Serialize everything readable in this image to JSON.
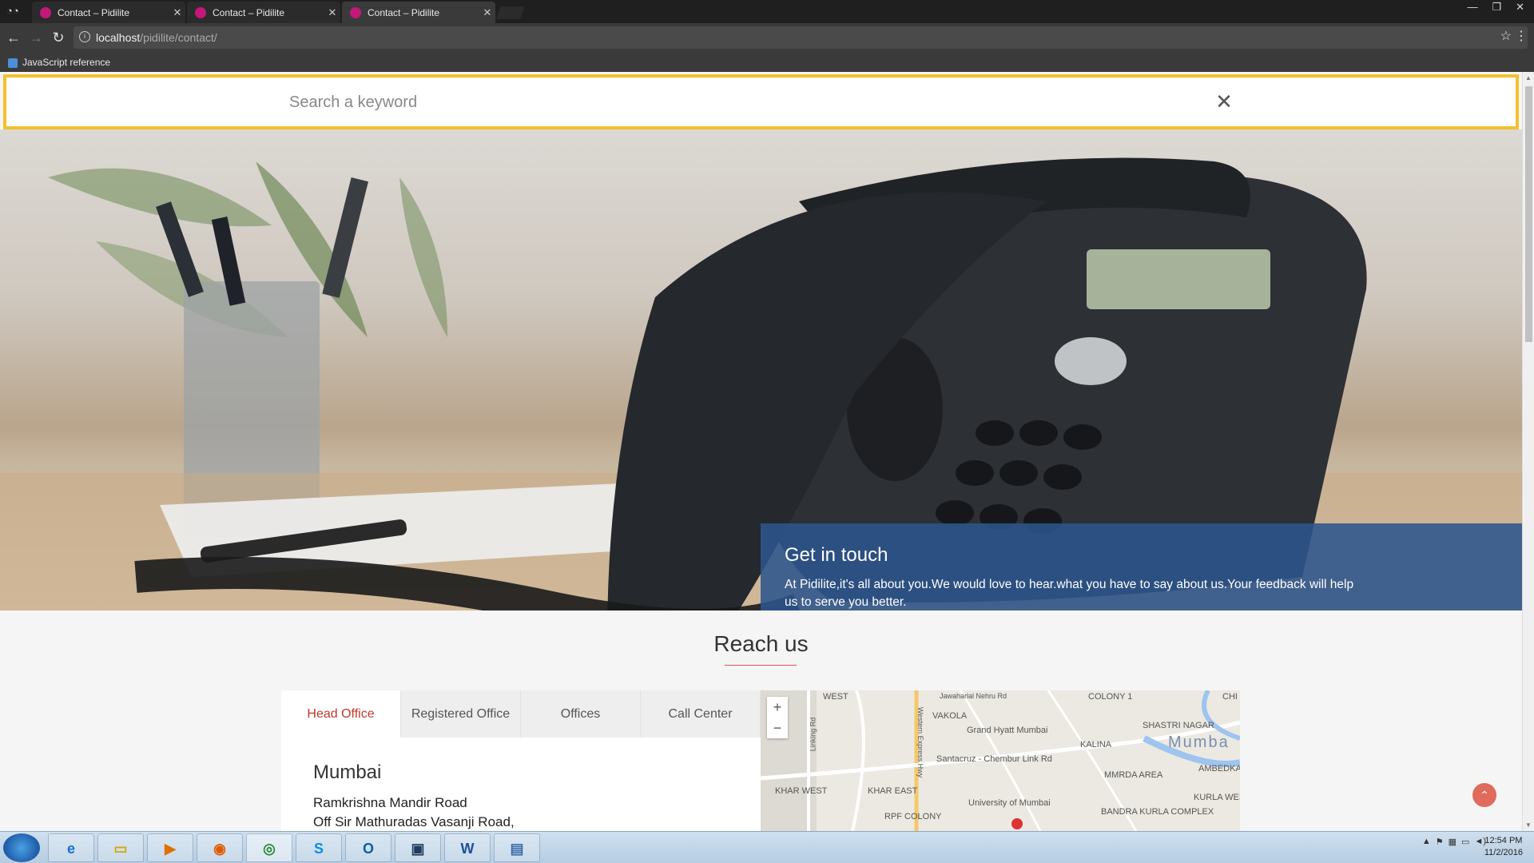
{
  "browser": {
    "tabs": [
      {
        "title": "Contact – Pidilite",
        "active": false
      },
      {
        "title": "Contact – Pidilite",
        "active": false
      },
      {
        "title": "Contact – Pidilite",
        "active": true
      }
    ],
    "url_host": "localhost",
    "url_path": "/pidilite/contact/",
    "bookmark": "JavaScript reference"
  },
  "search": {
    "placeholder": "Search a keyword"
  },
  "hero": {
    "title": "Get in touch",
    "text": "At Pidilite,it's all about you.We would love to hear.what you have to say about us.Your feedback will help us to serve you better."
  },
  "reach": {
    "title": "Reach us",
    "tabs": [
      "Head Office",
      "Registered Office",
      "Offices",
      "Call Center"
    ],
    "active_tab": "Head Office",
    "office_city": "Mumbai",
    "address_lines": [
      "Ramkrishna Mandir Road",
      "Off Sir Mathuradas Vasanji Road,"
    ]
  },
  "map": {
    "zoom_in": "+",
    "zoom_out": "−",
    "labels": [
      "WEST",
      "VAKOLA",
      "Grand Hyatt Mumbai",
      "COLONY 1",
      "SHASTRI NAGAR",
      "KALINA",
      "Mumba",
      "Santacruz - Chembur Link Rd",
      "MMRDA AREA",
      "AMBEDKA NAGAR",
      "KHAR WEST",
      "KHAR EAST",
      "University of Mumbai",
      "KURLA WES",
      "RPF COLONY",
      "BANDRA KURLA COMPLEX",
      "Jawaharlal Nehru Rd",
      "Linking Rd",
      "Western Express Hwy",
      "CHI"
    ]
  },
  "taskbar": {
    "time": "12:54 PM",
    "date": "11/2/2016"
  },
  "colors": {
    "accent": "#c0392b",
    "overlay": "#2c548c",
    "search_border": "#f2c12e"
  }
}
